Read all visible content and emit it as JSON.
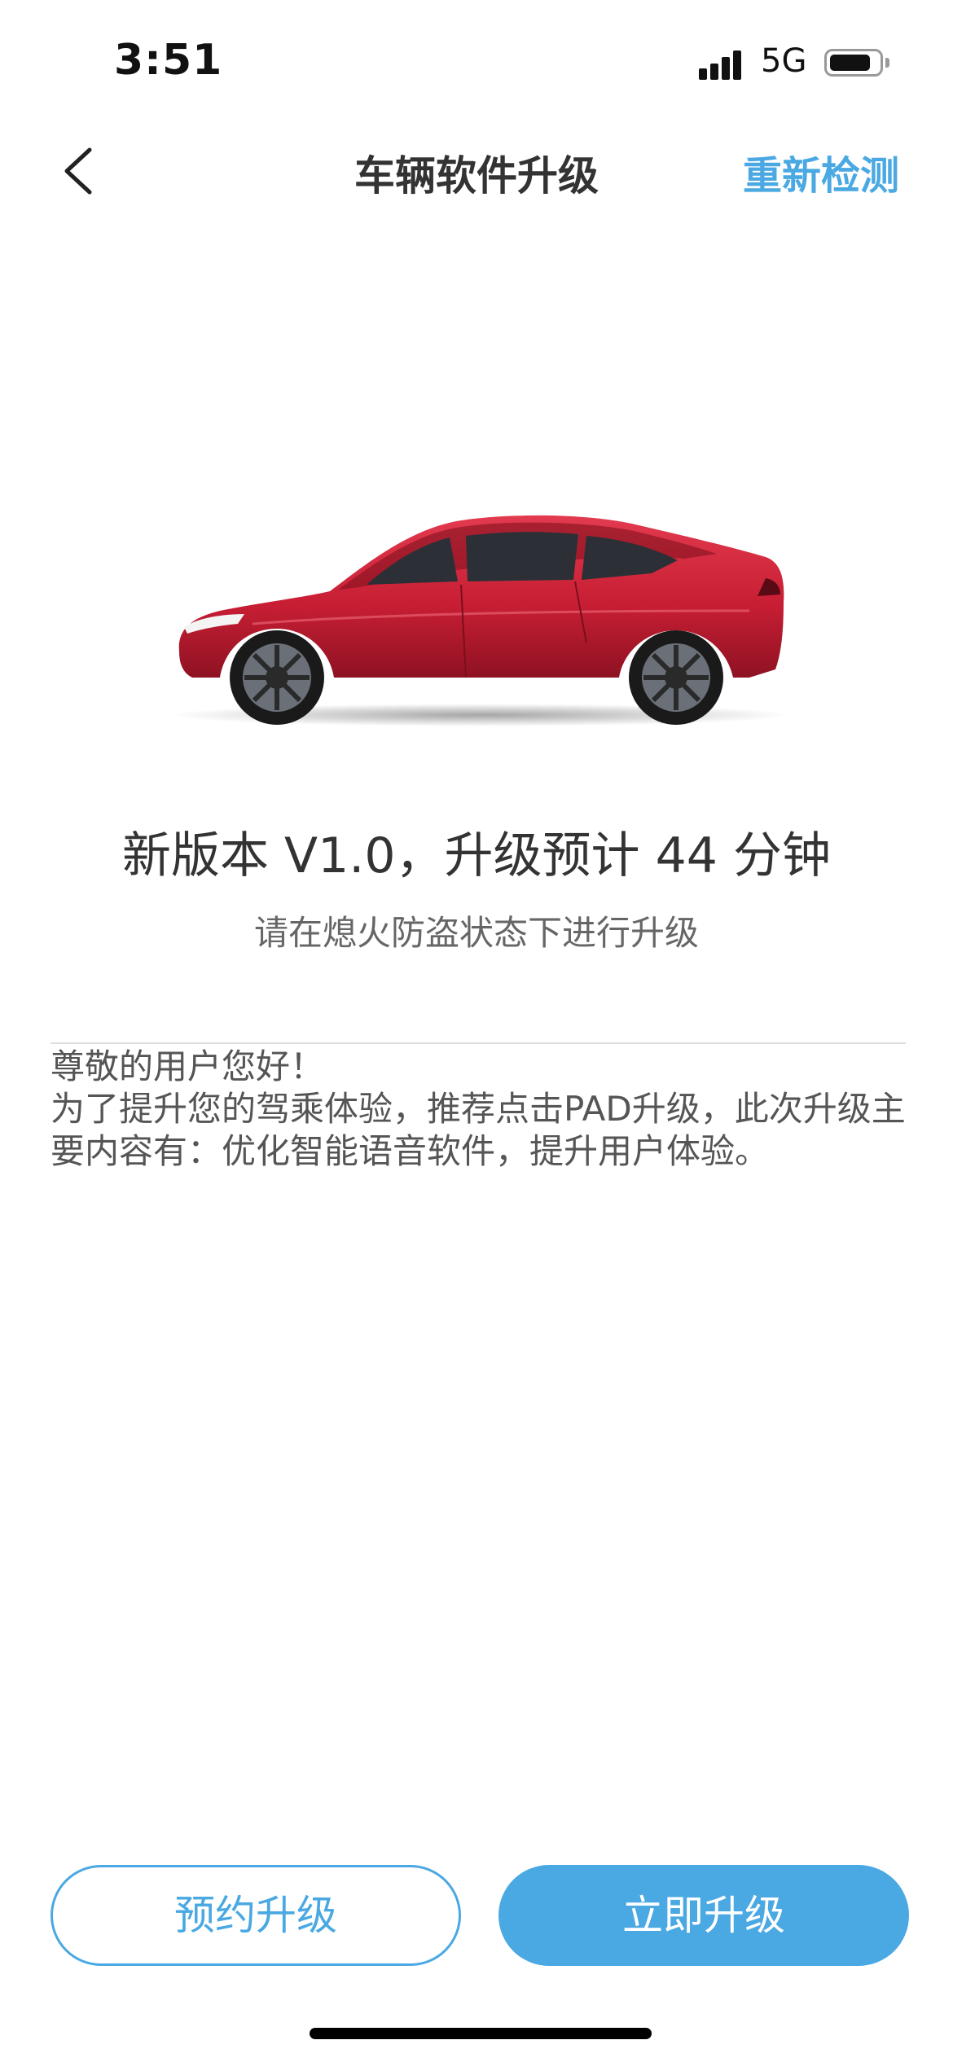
{
  "status_bar": {
    "time": "3:51",
    "network": "5G",
    "battery_level": 0.85,
    "signal_icon": "signal-bars-icon",
    "battery_icon": "battery-icon"
  },
  "nav": {
    "back_icon": "chevron-left-icon",
    "title": "车辆软件升级",
    "recheck_label": "重新检测"
  },
  "vehicle": {
    "image": "red-sedan-side-view",
    "body_color": "#c81e34"
  },
  "update": {
    "version_text": "新版本 V1.0，升级预计 44 分钟",
    "hint": "请在熄火防盗状态下进行升级"
  },
  "description": {
    "greeting": "尊敬的用户您好！",
    "body": "为了提升您的驾乘体验，推荐点击PAD升级，此次升级主要内容有：优化智能语音软件，提升用户体验。"
  },
  "actions": {
    "schedule_label": "预约升级",
    "now_label": "立即升级"
  },
  "colors": {
    "accent": "#4aa8e2",
    "text_primary": "#333333",
    "text_secondary": "#666666"
  }
}
